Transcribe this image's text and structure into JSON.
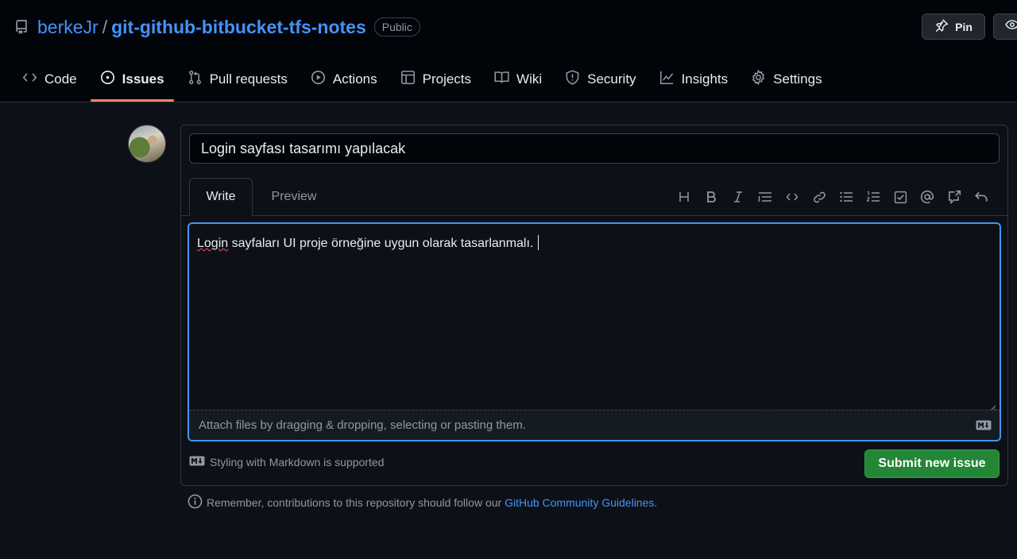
{
  "repo": {
    "owner": "berkeJr",
    "separator": "/",
    "name": "git-github-bitbucket-tfs-notes",
    "visibility": "Public"
  },
  "actions": {
    "pin_label": "Pin"
  },
  "nav": {
    "tabs": [
      {
        "label": "Code",
        "icon": "code-icon"
      },
      {
        "label": "Issues",
        "icon": "issue-opened-icon",
        "active": true
      },
      {
        "label": "Pull requests",
        "icon": "git-pull-request-icon"
      },
      {
        "label": "Actions",
        "icon": "play-icon"
      },
      {
        "label": "Projects",
        "icon": "table-icon"
      },
      {
        "label": "Wiki",
        "icon": "book-icon"
      },
      {
        "label": "Security",
        "icon": "shield-icon"
      },
      {
        "label": "Insights",
        "icon": "graph-icon"
      },
      {
        "label": "Settings",
        "icon": "gear-icon"
      }
    ]
  },
  "issue_form": {
    "title_value": "Login sayfası tasarımı yapılacak",
    "tabs": {
      "write": "Write",
      "preview": "Preview"
    },
    "body_spelled": "Login",
    "body_rest": " sayfaları UI proje örneğine uygun olarak tasarlanmalı.",
    "attach_hint": "Attach files by dragging & dropping, selecting or pasting them.",
    "markdown_hint": "Styling with Markdown is supported",
    "submit_label": "Submit new issue"
  },
  "toolbar": {
    "tools": [
      "heading-icon",
      "bold-icon",
      "italic-icon",
      "quote-icon",
      "code-icon",
      "link-icon",
      "unordered-list-icon",
      "ordered-list-icon",
      "task-list-icon",
      "mention-icon",
      "cross-reference-icon",
      "undo-icon"
    ]
  },
  "notice": {
    "prefix": "Remember, contributions to this repository should follow our ",
    "link": "GitHub Community Guidelines",
    "suffix": "."
  },
  "colors": {
    "background": "#0d1117",
    "header": "#010409",
    "link": "#4493f8",
    "accent_underline": "#f78166",
    "focus_border": "#4493f8",
    "submit": "#238636"
  }
}
